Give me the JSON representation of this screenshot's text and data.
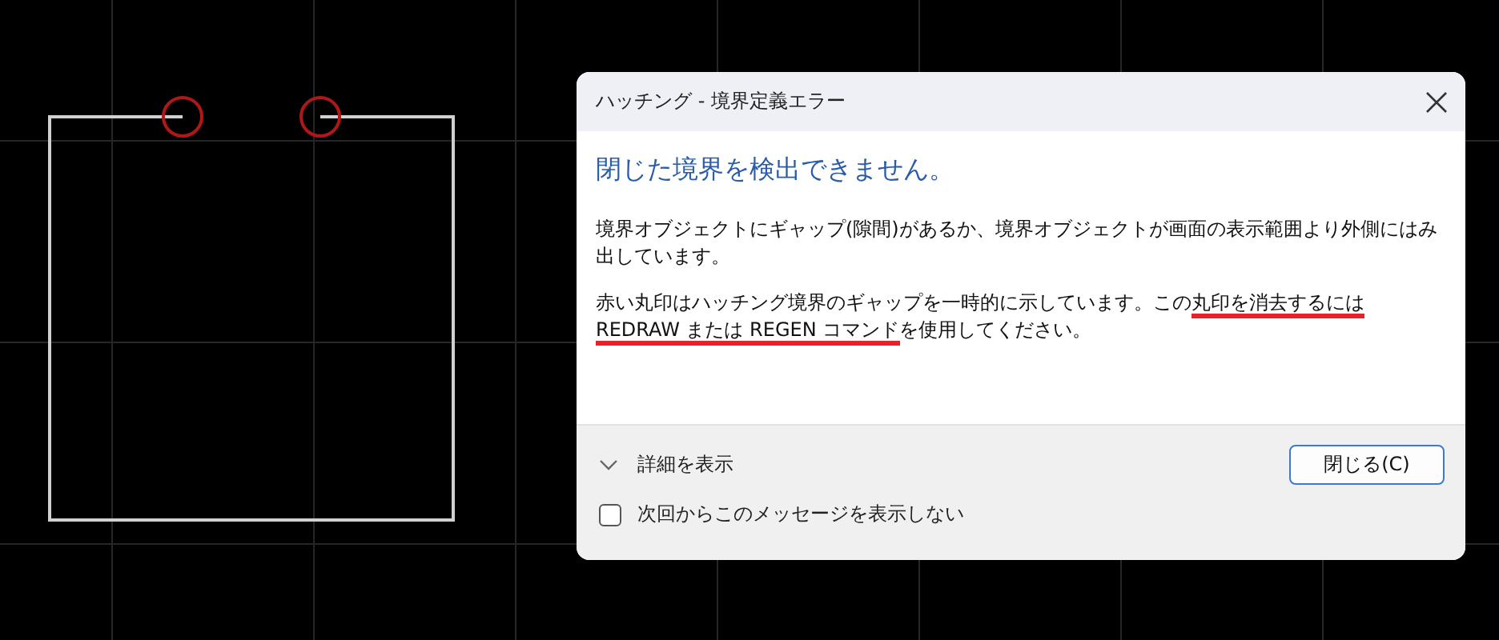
{
  "dialog": {
    "title": "ハッチング - 境界定義エラー",
    "heading": "閉じた境界を検出できません。",
    "paragraphs": [
      {
        "segments": [
          {
            "text": "境界オブジェクトにギャップ(隙間)があるか、境界オブジェクトが画面の表示範囲より外側にはみ出しています。",
            "marked": false
          }
        ]
      },
      {
        "segments": [
          {
            "text": "赤い丸印はハッチング境界のギャップを一時的に示しています。この",
            "marked": false
          },
          {
            "text": "丸印を消去するには",
            "marked": true
          },
          {
            "text": "REDRAW または REGEN コマンド",
            "marked": true
          },
          {
            "text": "を使用してください。",
            "marked": false
          }
        ]
      }
    ],
    "details": {
      "label": "詳細を表示",
      "expanded": false
    },
    "dont_show": {
      "label": "次回からこのメッセージを表示しない",
      "checked": false
    },
    "button": "閉じる(C)"
  }
}
